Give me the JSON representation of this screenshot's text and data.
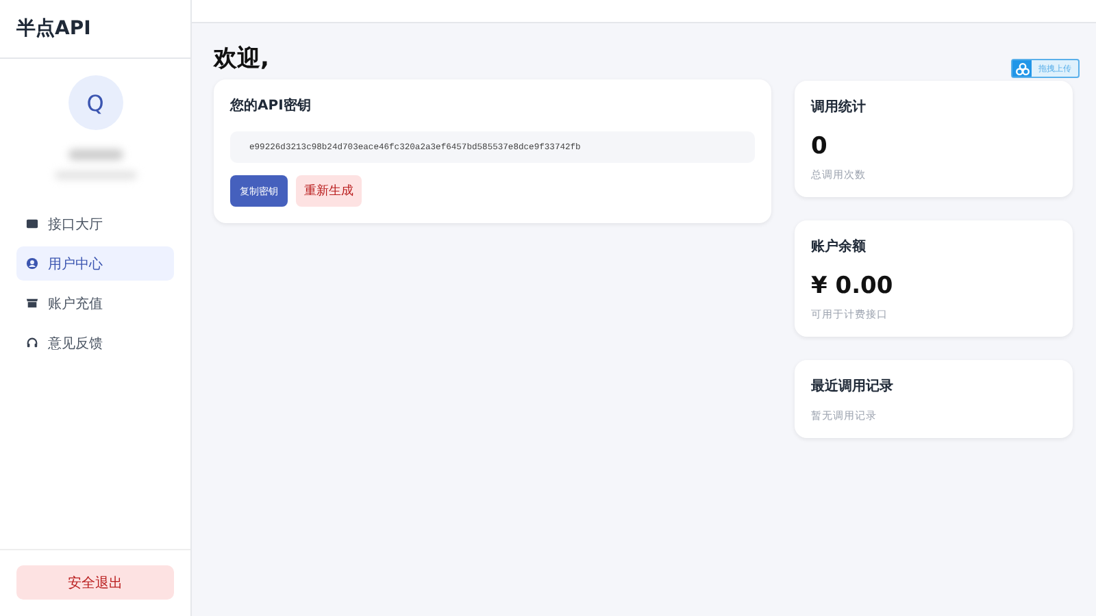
{
  "brand": "半点API",
  "user": {
    "avatar_letter": "Q"
  },
  "nav": [
    {
      "label": "接口大厅",
      "selected": false
    },
    {
      "label": "用户中心",
      "selected": true
    },
    {
      "label": "账户充值",
      "selected": false
    },
    {
      "label": "意见反馈",
      "selected": false
    }
  ],
  "logout": "安全退出",
  "greeting": "欢迎,",
  "api_key": {
    "title": "您的API密钥",
    "value": "e99226d3213c98b24d703eace46fc320a2a3ef6457bd585537e8dce9f33742fb",
    "copy_button": "复制密钥",
    "regenerate_button": "重新生成"
  },
  "stats": [
    {
      "title": "调用统计",
      "value": "0",
      "caption": "总调用次数"
    },
    {
      "title": "账户余额",
      "value": "¥ 0.00",
      "caption": "可用于计费接口"
    }
  ],
  "recent": {
    "title": "最近调用记录",
    "empty": "暂无调用记录"
  },
  "upload_badge": "拖拽上传"
}
